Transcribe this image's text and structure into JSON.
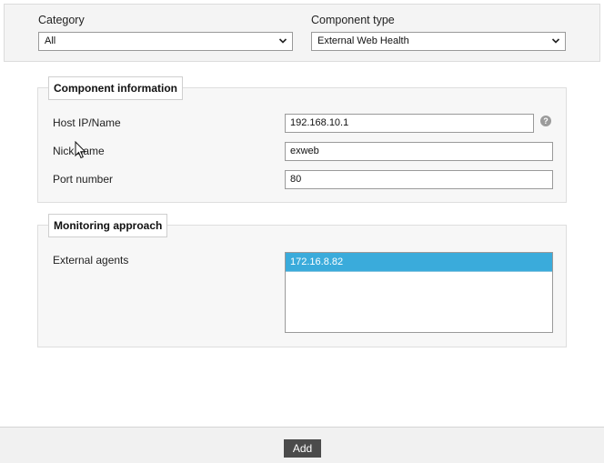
{
  "filters": {
    "category": {
      "label": "Category",
      "value": "All"
    },
    "component_type": {
      "label": "Component type",
      "value": "External Web Health"
    }
  },
  "component_info": {
    "legend": "Component information",
    "host": {
      "label": "Host IP/Name",
      "value": "192.168.10.1"
    },
    "nick": {
      "label": "Nick name",
      "value": "exweb"
    },
    "port": {
      "label": "Port number",
      "value": "80"
    },
    "help_glyph": "?"
  },
  "monitoring": {
    "legend": "Monitoring approach",
    "agents_label": "External agents",
    "agents": [
      {
        "value": "172.16.8.82",
        "selected": true
      }
    ]
  },
  "footer": {
    "add_label": "Add"
  },
  "colors": {
    "accent": "#3aabdb",
    "button_bg": "#4b4b4b"
  },
  "icons": {
    "dropdown": "chevron-down-icon",
    "help": "question-mark-icon",
    "cursor": "mouse-pointer-icon"
  }
}
